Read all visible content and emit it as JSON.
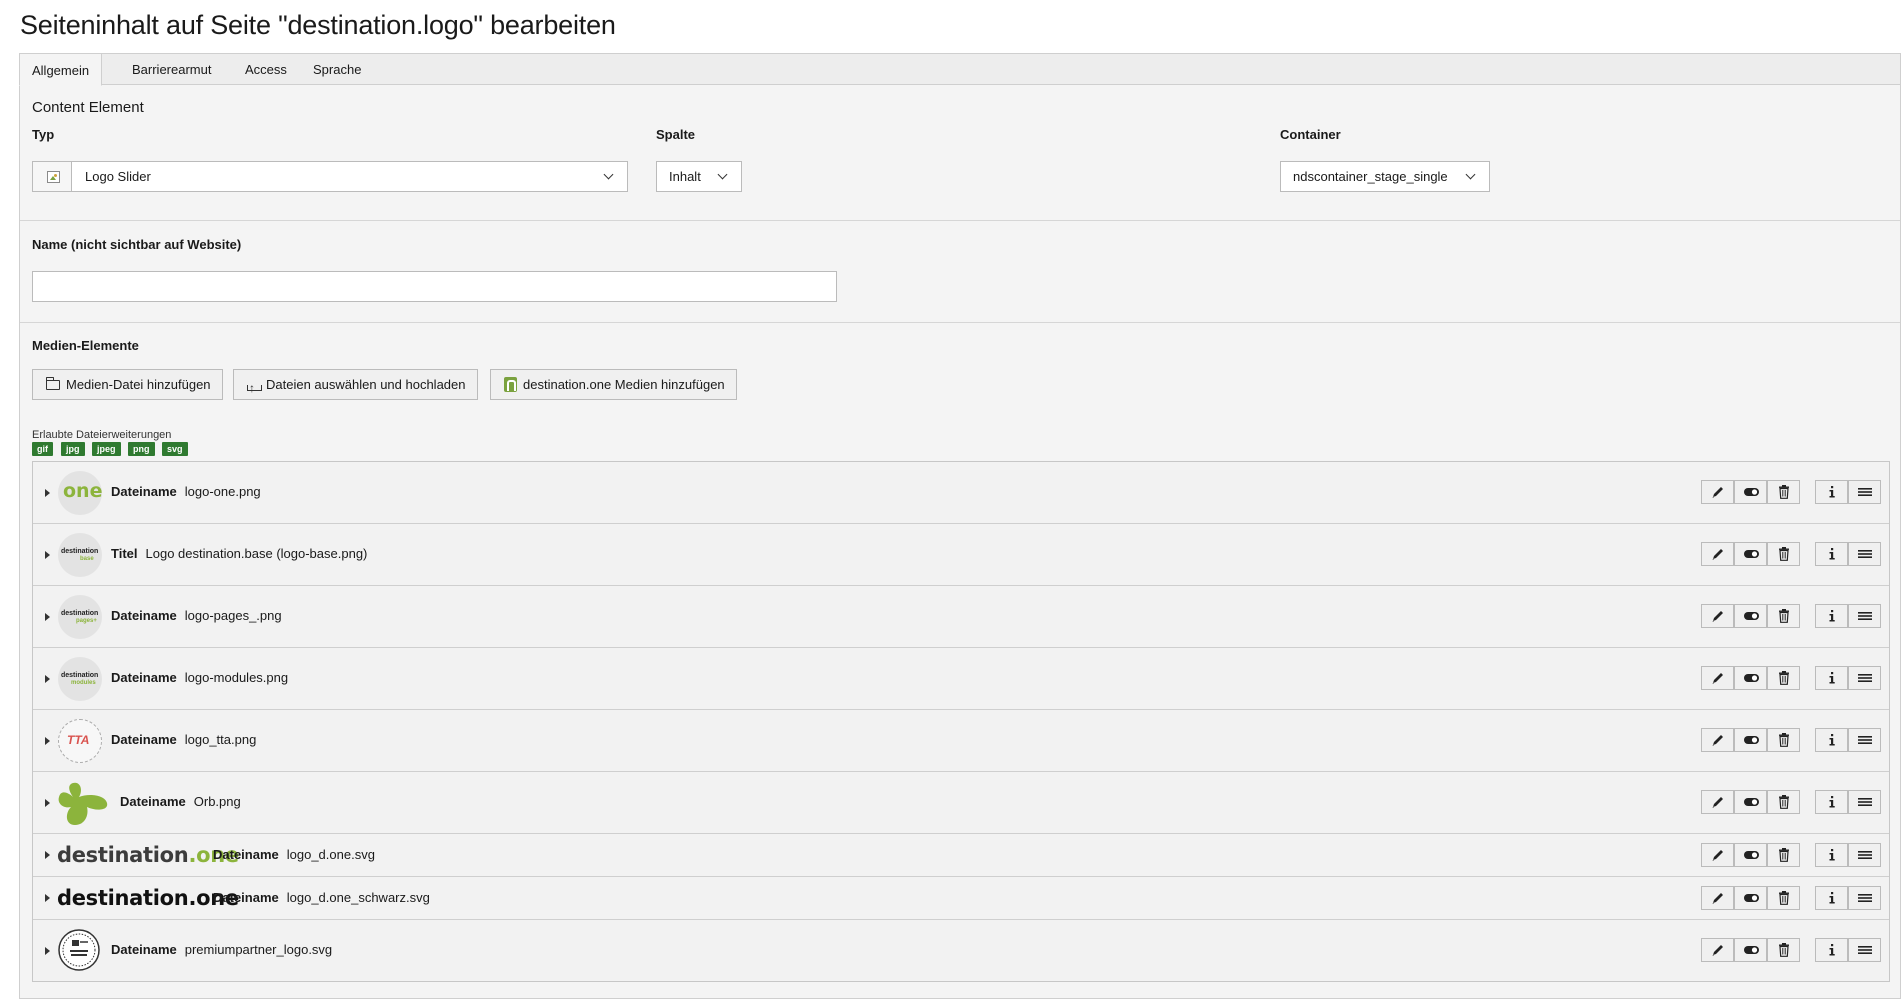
{
  "page_title": "Seiteninhalt auf Seite \"destination.logo\" bearbeiten",
  "tabs": [
    {
      "label": "Allgemein",
      "active": true
    },
    {
      "label": "Barrierearmut",
      "active": false
    },
    {
      "label": "Access",
      "active": false
    },
    {
      "label": "Sprache",
      "active": false
    }
  ],
  "general": {
    "section_heading": "Content Element",
    "type_label": "Typ",
    "type_value": "Logo Slider",
    "column_label": "Spalte",
    "column_value": "Inhalt",
    "container_label": "Container",
    "container_value": "ndscontainer_stage_single"
  },
  "name_field": {
    "label": "Name (nicht sichtbar auf Website)",
    "value": ""
  },
  "media": {
    "label": "Medien-Elemente",
    "buttons": {
      "add_media": "Medien-Datei hinzufügen",
      "upload": "Dateien auswählen und hochladen",
      "d1_media": "destination.one Medien hinzufügen"
    },
    "allowed_label": "Erlaubte Dateierweiterungen",
    "extensions": [
      "gif",
      "jpg",
      "jpeg",
      "png",
      "svg"
    ],
    "items": [
      {
        "key": "Dateiname",
        "value": "logo-one.png",
        "thumb": "one"
      },
      {
        "key": "Titel",
        "value": "Logo destination.base (logo-base.png)",
        "thumb": "base"
      },
      {
        "key": "Dateiname",
        "value": "logo-pages_.png",
        "thumb": "pages"
      },
      {
        "key": "Dateiname",
        "value": "logo-modules.png",
        "thumb": "modules"
      },
      {
        "key": "Dateiname",
        "value": "logo_tta.png",
        "thumb": "tta"
      },
      {
        "key": "Dateiname",
        "value": "Orb.png",
        "thumb": "orb"
      },
      {
        "key": "Dateiname",
        "value": "logo_d.one.svg",
        "thumb": "d1-green"
      },
      {
        "key": "Dateiname",
        "value": "logo_d.one_schwarz.svg",
        "thumb": "d1-black"
      },
      {
        "key": "Dateiname",
        "value": "premiumpartner_logo.svg",
        "thumb": "premium"
      }
    ],
    "action_icons": [
      "edit-icon",
      "toggle-visibility-icon",
      "delete-icon",
      "info-icon",
      "drag-handle-icon"
    ]
  },
  "logos": {
    "one_text": "one",
    "destination_text": "destination",
    "base_text": "base",
    "pages_text": "pages+",
    "modules_text": "modules",
    "tta_text": "TTA",
    "d1_prefix": "destination",
    "d1_suffix": ".one"
  },
  "colors": {
    "accent_green": "#8cb43c",
    "extension_badge": "#2f7a30",
    "tta_red": "#d9534f"
  }
}
